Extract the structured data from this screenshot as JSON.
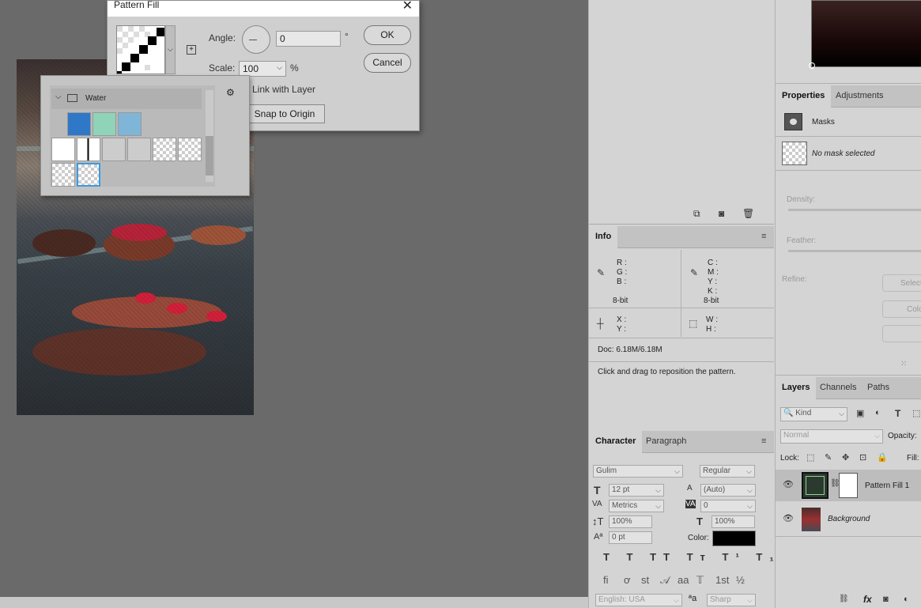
{
  "dialog": {
    "title": "Pattern Fill",
    "angle_label": "Angle:",
    "angle_value": "0",
    "degree": "°",
    "scale_label": "Scale:",
    "scale_value": "100",
    "percent": "%",
    "ok": "OK",
    "cancel": "Cancel",
    "link_label": "Link with Layer",
    "snap_label": "Snap to Origin"
  },
  "picker": {
    "folder": "Water",
    "gear": "⚙"
  },
  "left_panel": {
    "icons": [
      "new-adjust-icon",
      "camera-icon",
      "trash-icon"
    ]
  },
  "info": {
    "tab": "Info",
    "r": "R :",
    "g": "G :",
    "b": "B :",
    "c": "C :",
    "m": "M :",
    "y": "Y :",
    "k": "K :",
    "bit1": "8-bit",
    "bit2": "8-bit",
    "x": "X :",
    "y2": "Y :",
    "w": "W :",
    "h": "H :",
    "doc": "Doc: 6.18M/6.18M",
    "hint": "Click and drag to reposition the pattern."
  },
  "character": {
    "tab1": "Character",
    "tab2": "Paragraph",
    "font": "Gulim",
    "style": "Regular",
    "size": "12 pt",
    "leading": "(Auto)",
    "kerning": "Metrics",
    "tracking": "0",
    "vscale": "100%",
    "hscale": "100%",
    "baseline": "0 pt",
    "color_label": "Color:",
    "fi": "fi",
    "st": "st",
    "aa_glyph": "aa",
    "frac": "½",
    "first": "1st",
    "lang": "English: USA",
    "aa": "Sharp",
    "color": "#000000"
  },
  "properties": {
    "tab1": "Properties",
    "tab2": "Adjustments",
    "masks": "Masks",
    "no_mask": "No mask selected",
    "density": "Density:",
    "feather": "Feather:",
    "refine": "Refine:",
    "btn1": "Select",
    "btn2": "Colo"
  },
  "layers": {
    "tab1": "Layers",
    "tab2": "Channels",
    "tab3": "Paths",
    "kind": "Kind",
    "mode": "Normal",
    "opacity": "Opacity:",
    "lock": "Lock:",
    "fill": "Fill:",
    "items": [
      {
        "name": "Pattern Fill 1"
      },
      {
        "name": "Background"
      }
    ],
    "fx": "fx"
  }
}
